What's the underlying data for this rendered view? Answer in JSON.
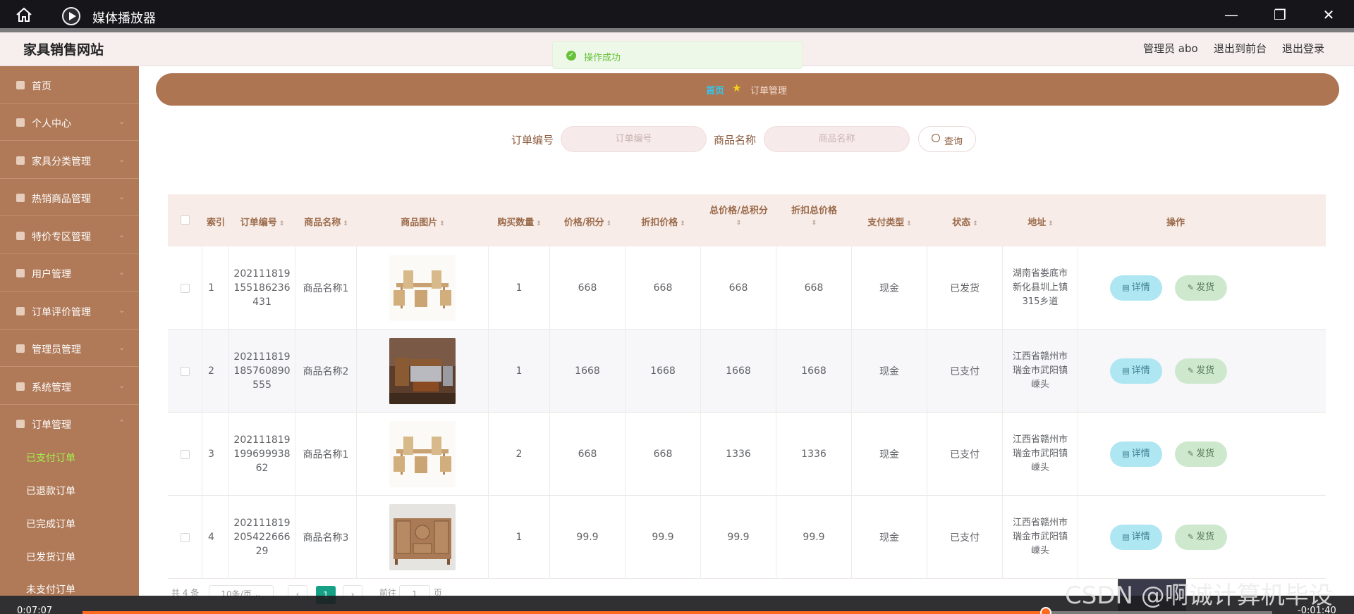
{
  "player": {
    "title": "媒体播放器",
    "time_elapsed": "0:07:07",
    "time_remaining": "-0:01:40",
    "progress_percent": 81
  },
  "site": {
    "brand": "家具销售网站",
    "header_links": [
      "管理员 abo",
      "退出到前台",
      "退出登录"
    ]
  },
  "toast": {
    "message": "操作成功"
  },
  "sidebar": {
    "items": [
      {
        "label": "首页",
        "icon": "home-icon",
        "expandable": false
      },
      {
        "label": "个人中心",
        "icon": "user-icon",
        "expandable": true
      },
      {
        "label": "家具分类管理",
        "icon": "folder-icon",
        "expandable": true
      },
      {
        "label": "热销商品管理",
        "icon": "doc-icon",
        "expandable": true
      },
      {
        "label": "特价专区管理",
        "icon": "tag-icon",
        "expandable": true
      },
      {
        "label": "用户管理",
        "icon": "grid-icon",
        "expandable": true
      },
      {
        "label": "订单评价管理",
        "icon": "phone-icon",
        "expandable": true
      },
      {
        "label": "管理员管理",
        "icon": "shield-icon",
        "expandable": true
      },
      {
        "label": "系统管理",
        "icon": "settings-icon",
        "expandable": true
      },
      {
        "label": "订单管理",
        "icon": "order-icon",
        "expandable": true,
        "expanded": true
      }
    ],
    "subitems": [
      "已支付订单",
      "已退款订单",
      "已完成订单",
      "已发货订单",
      "未支付订单"
    ],
    "active_subitem": 0
  },
  "breadcrumb": {
    "home": "首页",
    "current": "订单管理"
  },
  "search": {
    "order_no_label": "订单编号",
    "order_no_placeholder": "订单编号",
    "product_label": "商品名称",
    "product_placeholder": "商品名称",
    "query_button": "查询"
  },
  "table": {
    "columns": [
      "索引",
      "订单编号",
      "商品名称",
      "商品图片",
      "购买数量",
      "价格/积分",
      "折扣价格",
      "总价格/总积分",
      "折扣总价格",
      "支付类型",
      "状态",
      "地址",
      "操作"
    ],
    "rows": [
      {
        "index": "1",
        "order_no": "202111819155186236431",
        "product": "商品名称1",
        "image": "dining-set",
        "qty": "1",
        "price": "668",
        "discount": "668",
        "total": "668",
        "discount_total": "668",
        "pay": "现金",
        "status": "已发货",
        "address": "湖南省娄底市新化县圳上镇315乡道"
      },
      {
        "index": "2",
        "order_no": "202111819185760890555",
        "product": "商品名称2",
        "image": "sofa-set",
        "qty": "1",
        "price": "1668",
        "discount": "1668",
        "total": "1668",
        "discount_total": "1668",
        "pay": "现金",
        "status": "已支付",
        "address": "江西省赣州市瑞金市武阳镇嵊头"
      },
      {
        "index": "3",
        "order_no": "20211181919969993862",
        "product": "商品名称1",
        "image": "dining-set",
        "qty": "2",
        "price": "668",
        "discount": "668",
        "total": "1336",
        "discount_total": "1336",
        "pay": "现金",
        "status": "已支付",
        "address": "江西省赣州市瑞金市武阳镇嵊头"
      },
      {
        "index": "4",
        "order_no": "20211181920542266629",
        "product": "商品名称3",
        "image": "cabinet",
        "qty": "1",
        "price": "99.9",
        "discount": "99.9",
        "total": "99.9",
        "discount_total": "99.9",
        "pay": "现金",
        "status": "已支付",
        "address": "江西省赣州市瑞金市武阳镇嵊头"
      }
    ],
    "detail_button": "详情",
    "ship_button": "发货"
  },
  "pagination": {
    "total": "共 4 条",
    "page_size": "10条/页",
    "current_page": "1",
    "goto_label": "前往",
    "goto_value": "1",
    "page_suffix": "页"
  },
  "watermark": "CSDN @啊诚计算机毕设"
}
